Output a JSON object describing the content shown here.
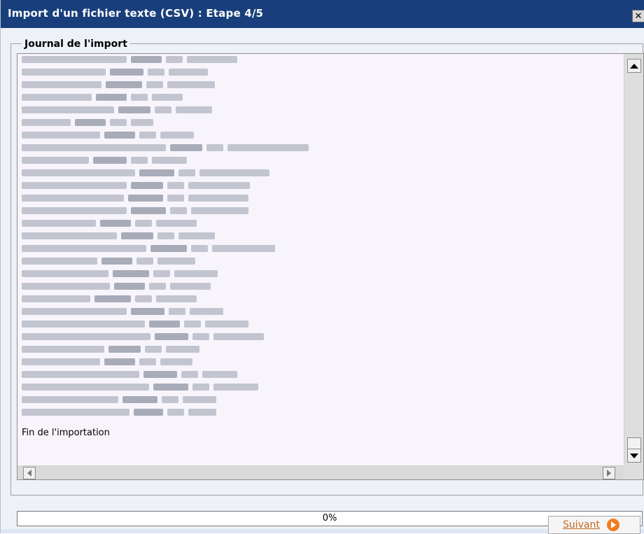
{
  "window": {
    "title": "Import d'un fichier texte (CSV) : Etape 4/5",
    "close_symbol": "✕"
  },
  "journal": {
    "legend": "Journal de l'import",
    "final_message": "Fin de l'importation"
  },
  "progress": {
    "value_percent": 0,
    "label": "0%"
  },
  "actions": {
    "next_label": "Suivant",
    "next_icon": "arrow-right-circle-icon"
  },
  "colors": {
    "titlebar": "#183f7b",
    "log_background": "#f8f4fb",
    "accent": "#ef7d22",
    "progress_fill": "#6d95d6"
  }
}
